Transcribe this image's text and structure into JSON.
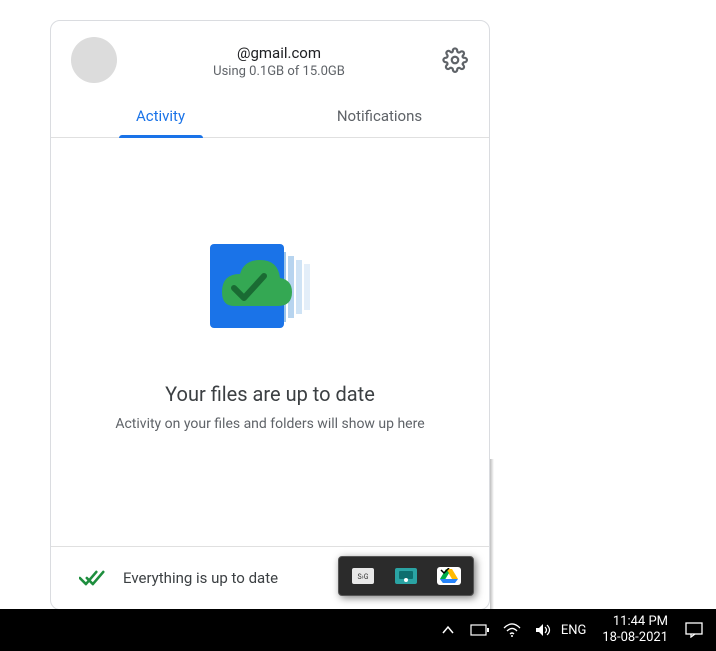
{
  "account": {
    "email": "@gmail.com",
    "storage": "Using 0.1GB of 15.0GB"
  },
  "tabs": {
    "activity": "Activity",
    "notifications": "Notifications"
  },
  "hero": {
    "title": "Your files are up to date",
    "subtitle": "Activity on your files and folders will show up here"
  },
  "status": {
    "text": "Everything is up to date"
  },
  "taskbar": {
    "language": "ENG",
    "time": "11:44 PM",
    "date": "18-08-2021"
  }
}
